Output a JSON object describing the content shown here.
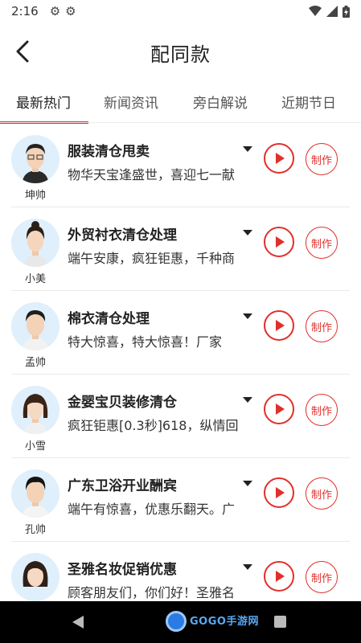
{
  "status_bar": {
    "time": "2:16",
    "icons": [
      "gear-icon",
      "gear-icon",
      "wifi-icon",
      "signal-icon",
      "battery-icon"
    ]
  },
  "header": {
    "title": "配同款",
    "back_icon": "back-arrow-icon"
  },
  "tabs": [
    {
      "label": "最新热门",
      "active": true
    },
    {
      "label": "新闻资讯",
      "active": false
    },
    {
      "label": "旁白解说",
      "active": false
    },
    {
      "label": "近期节日",
      "active": false
    }
  ],
  "accent_color": "#e0302c",
  "list": [
    {
      "name": "坤帅",
      "title": "服装清仓甩卖",
      "desc": "物华天宝逢盛世，喜迎七一献",
      "make": "制作"
    },
    {
      "name": "小美",
      "title": "外贸衬衣清仓处理",
      "desc": "端午安康，疯狂钜惠，千种商",
      "make": "制作"
    },
    {
      "name": "孟帅",
      "title": "棉衣清仓处理",
      "desc": "特大惊喜，特大惊喜！厂家",
      "make": "制作"
    },
    {
      "name": "小雪",
      "title": "金婴宝贝装修清仓",
      "desc": "疯狂钜惠[0.3秒]618，纵情回",
      "make": "制作"
    },
    {
      "name": "孔帅",
      "title": "广东卫浴开业酬宾",
      "desc": "端午有惊喜，优惠乐翻天。广",
      "make": "制作"
    },
    {
      "name": "",
      "title": "圣雅名妆促销优惠",
      "desc": "顾客朋友们，你们好！圣雅名",
      "make": "制作"
    }
  ],
  "nav_bar": {
    "watermark": "GOGO手游网"
  }
}
